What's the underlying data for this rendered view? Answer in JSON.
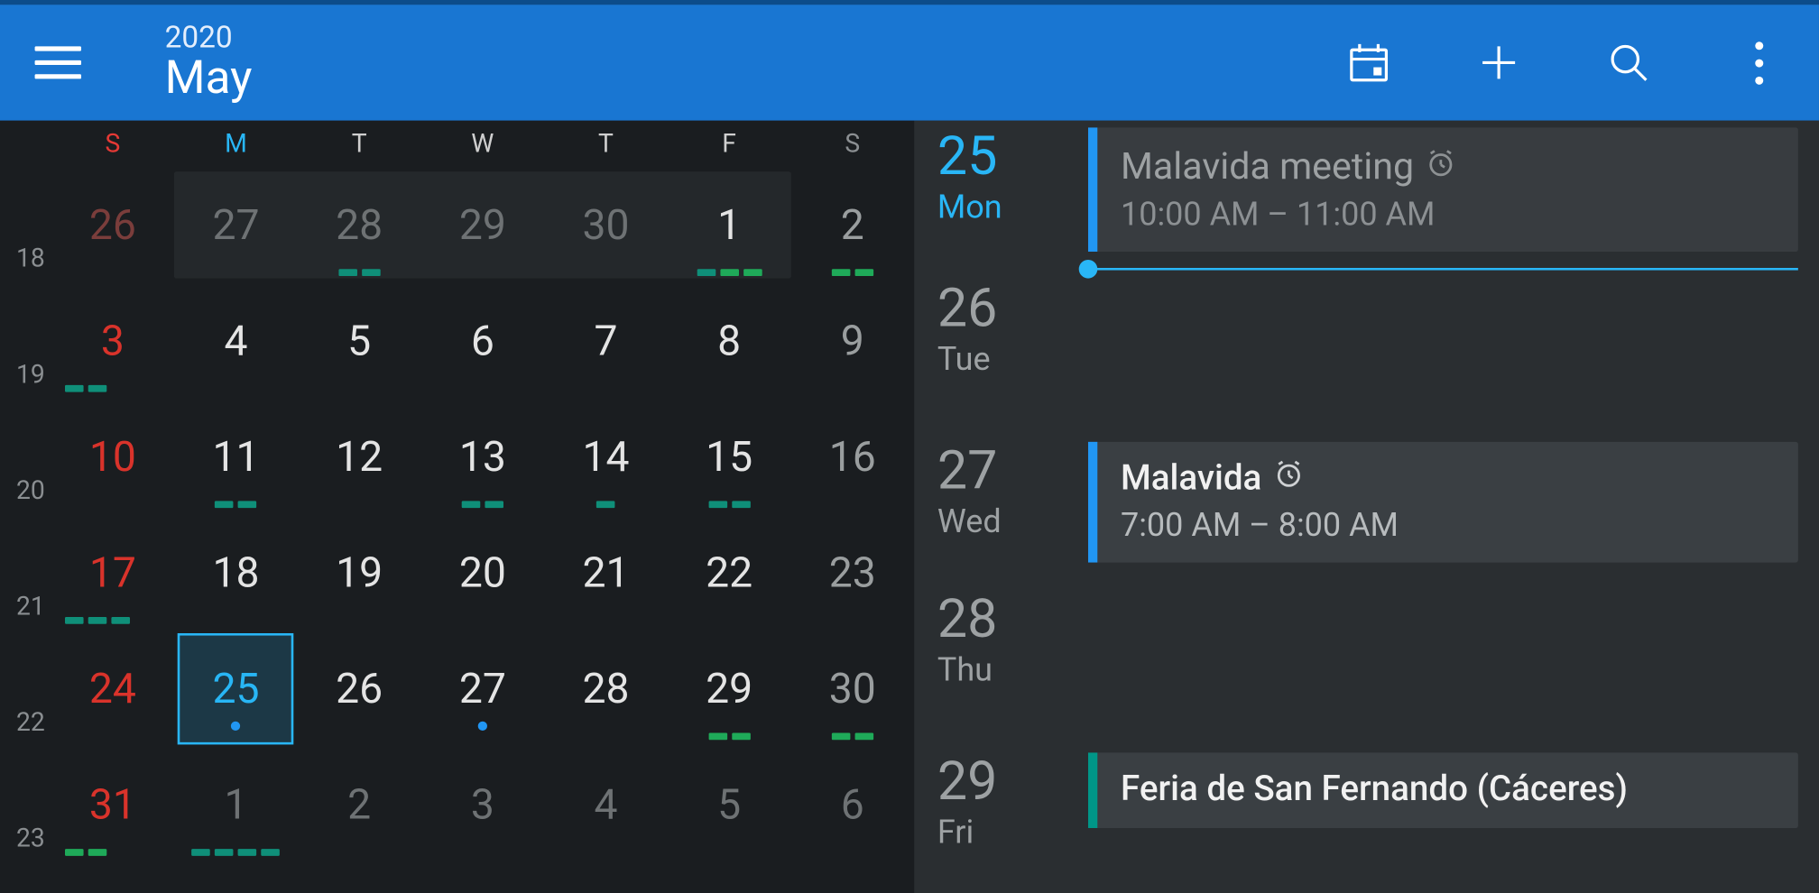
{
  "header": {
    "year": "2020",
    "month": "May"
  },
  "dow": [
    "S",
    "M",
    "T",
    "W",
    "T",
    "F",
    "S"
  ],
  "weeks": [
    {
      "num": "18",
      "shade": {
        "start": 1,
        "end": 5
      },
      "days": [
        {
          "d": "26",
          "cls": "c-other-sun"
        },
        {
          "d": "27",
          "cls": "c-other"
        },
        {
          "d": "28",
          "cls": "c-other",
          "marks": [
            {
              "t": "mk-teal"
            },
            {
              "t": "mk-teal"
            }
          ]
        },
        {
          "d": "29",
          "cls": "c-other"
        },
        {
          "d": "30",
          "cls": "c-other"
        },
        {
          "d": "1",
          "cls": "c-cur",
          "marks": [
            {
              "t": "mk-teal"
            },
            {
              "t": "mk-green"
            },
            {
              "t": "mk-green"
            }
          ]
        },
        {
          "d": "2",
          "cls": "c-sat",
          "marks": [
            {
              "t": "mk-green"
            },
            {
              "t": "mk-green"
            }
          ]
        }
      ]
    },
    {
      "num": "19",
      "days": [
        {
          "d": "3",
          "cls": "c-sun",
          "marks": [
            {
              "t": "mk-teal"
            },
            {
              "t": "mk-teal"
            }
          ],
          "marksLeft": true
        },
        {
          "d": "4",
          "cls": "c-cur"
        },
        {
          "d": "5",
          "cls": "c-cur"
        },
        {
          "d": "6",
          "cls": "c-cur"
        },
        {
          "d": "7",
          "cls": "c-cur"
        },
        {
          "d": "8",
          "cls": "c-cur"
        },
        {
          "d": "9",
          "cls": "c-sat"
        }
      ]
    },
    {
      "num": "20",
      "days": [
        {
          "d": "10",
          "cls": "c-sun"
        },
        {
          "d": "11",
          "cls": "c-cur",
          "marks": [
            {
              "t": "mk-teal"
            },
            {
              "t": "mk-teal"
            }
          ]
        },
        {
          "d": "12",
          "cls": "c-cur"
        },
        {
          "d": "13",
          "cls": "c-cur",
          "marks": [
            {
              "t": "mk-teal"
            },
            {
              "t": "mk-teal"
            }
          ]
        },
        {
          "d": "14",
          "cls": "c-cur",
          "marks": [
            {
              "t": "mk-teal"
            }
          ]
        },
        {
          "d": "15",
          "cls": "c-cur",
          "marks": [
            {
              "t": "mk-teal"
            },
            {
              "t": "mk-teal"
            }
          ]
        },
        {
          "d": "16",
          "cls": "c-sat"
        }
      ]
    },
    {
      "num": "21",
      "days": [
        {
          "d": "17",
          "cls": "c-sun",
          "marks": [
            {
              "t": "mk-teal"
            },
            {
              "t": "mk-teal"
            },
            {
              "t": "mk-teal"
            }
          ],
          "marksLeft": true
        },
        {
          "d": "18",
          "cls": "c-cur"
        },
        {
          "d": "19",
          "cls": "c-cur"
        },
        {
          "d": "20",
          "cls": "c-cur"
        },
        {
          "d": "21",
          "cls": "c-cur"
        },
        {
          "d": "22",
          "cls": "c-cur"
        },
        {
          "d": "23",
          "cls": "c-sat"
        }
      ]
    },
    {
      "num": "22",
      "days": [
        {
          "d": "24",
          "cls": "c-sun"
        },
        {
          "d": "25",
          "cls": "c-today",
          "today": true,
          "dot": "#2196f3"
        },
        {
          "d": "26",
          "cls": "c-cur"
        },
        {
          "d": "27",
          "cls": "c-cur",
          "dot": "#2196f3"
        },
        {
          "d": "28",
          "cls": "c-cur"
        },
        {
          "d": "29",
          "cls": "c-cur",
          "marks": [
            {
              "t": "mk-green"
            },
            {
              "t": "mk-green"
            }
          ]
        },
        {
          "d": "30",
          "cls": "c-sat",
          "marks": [
            {
              "t": "mk-green"
            },
            {
              "t": "mk-green"
            }
          ]
        }
      ]
    },
    {
      "num": "23",
      "days": [
        {
          "d": "31",
          "cls": "c-sun",
          "marks": [
            {
              "t": "mk-green"
            },
            {
              "t": "mk-green"
            }
          ],
          "marksLeft": true
        },
        {
          "d": "1",
          "cls": "c-other",
          "marks": [
            {
              "t": "mk-teal"
            },
            {
              "t": "mk-teal"
            },
            {
              "t": "mk-teal"
            },
            {
              "t": "mk-teal"
            }
          ]
        },
        {
          "d": "2",
          "cls": "c-other"
        },
        {
          "d": "3",
          "cls": "c-other"
        },
        {
          "d": "4",
          "cls": "c-other"
        },
        {
          "d": "5",
          "cls": "c-other"
        },
        {
          "d": "6",
          "cls": "c-other"
        }
      ]
    }
  ],
  "agenda": [
    {
      "num": "25",
      "dow": "Mon",
      "today": true,
      "nowline": true,
      "events": [
        {
          "title": "Malavida meeting",
          "time": "10:00 AM – 11:00 AM",
          "accent": "acc-blue",
          "alarm": true,
          "dim": true
        }
      ]
    },
    {
      "num": "26",
      "dow": "Tue",
      "events": []
    },
    {
      "num": "27",
      "dow": "Wed",
      "events": [
        {
          "title": "Malavida",
          "time": "7:00 AM – 8:00 AM",
          "accent": "acc-blue",
          "alarm": true
        }
      ]
    },
    {
      "num": "28",
      "dow": "Thu",
      "events": []
    },
    {
      "num": "29",
      "dow": "Fri",
      "events": [
        {
          "title": "Feria de San Fernando (Cáceres)",
          "time": "",
          "accent": "acc-teal"
        }
      ]
    }
  ]
}
